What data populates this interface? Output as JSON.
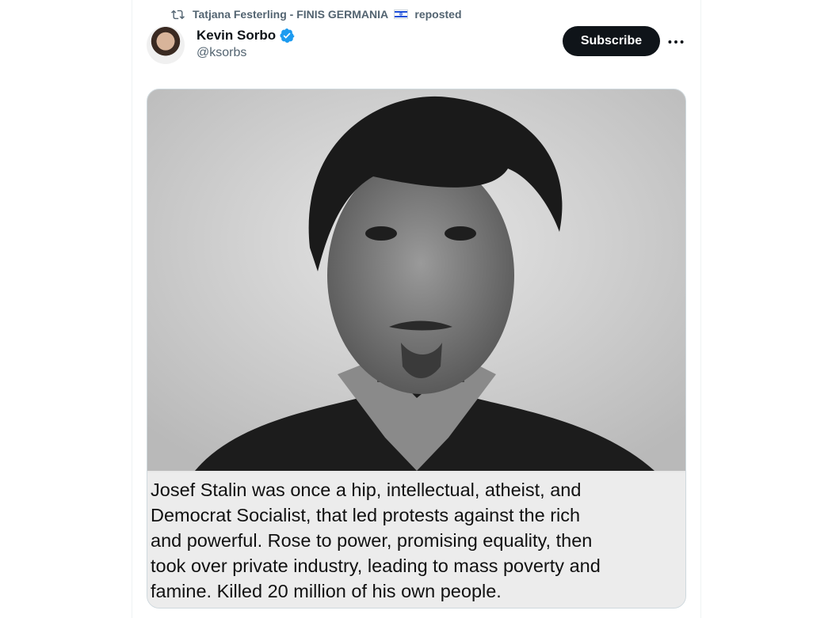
{
  "repost": {
    "reposter": "Tatjana Festerling - FINIS GERMANIA",
    "flag_icon": "israel-flag-icon",
    "suffix": "reposted"
  },
  "author": {
    "name": "Kevin Sorbo",
    "handle": "@ksorbs",
    "verified": true
  },
  "actions": {
    "subscribe_label": "Subscribe",
    "more_icon": "more-dots-icon"
  },
  "media": {
    "caption_lines": [
      "Josef Stalin was once a hip, intellectual, atheist, and",
      "Democrat Socialist, that led protests against the rich",
      "and powerful. Rose to power, promising equality, then",
      "took over private industry, leading to mass poverty and",
      "famine. Killed 20 million of his own people."
    ]
  },
  "colors": {
    "accent": "#1d9bf0",
    "muted": "#536471",
    "button_bg": "#0f1419"
  }
}
